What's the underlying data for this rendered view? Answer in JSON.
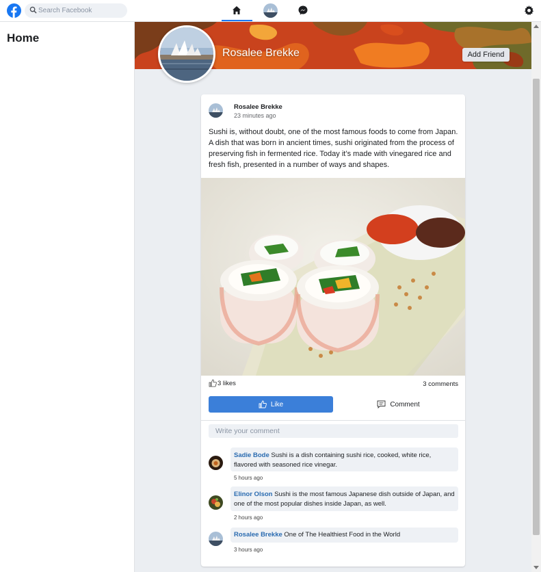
{
  "topbar": {
    "search_placeholder": "Search Facebook"
  },
  "sidebar": {
    "title": "Home"
  },
  "profile": {
    "name": "Rosalee Brekke",
    "add_friend_label": "Add Friend"
  },
  "post": {
    "author": "Rosalee Brekke",
    "time": "23 minutes ago",
    "text": "Sushi is, without doubt, one of the most famous foods to come from Japan. A dish that was born in ancient times, sushi originated from the process of preserving fish in fermented rice. Today it’s made with vinegared rice and fresh fish, presented in a number of ways and shapes.",
    "likes": "3 likes",
    "comments_count": "3 comments",
    "like_label": "Like",
    "comment_label": "Comment",
    "write_placeholder": "Write your comment"
  },
  "comments": [
    {
      "name": "Sadie Bode",
      "text": "Sushi is a dish containing sushi rice, cooked, white rice, flavored with seasoned rice vinegar.",
      "time": "5 hours ago"
    },
    {
      "name": "Elinor Olson",
      "text": "Sushi is the most famous Japanese dish outside of Japan, and one of the most popular dishes inside Japan, as well.",
      "time": "2 hours ago"
    },
    {
      "name": "Rosalee Brekke",
      "text": "One of The Healthiest Food in the World",
      "time": "3 hours ago"
    }
  ],
  "colors": {
    "brand": "#1877f2",
    "like_button": "#3b7fd9",
    "commenter_name": "#2a6bb0"
  }
}
